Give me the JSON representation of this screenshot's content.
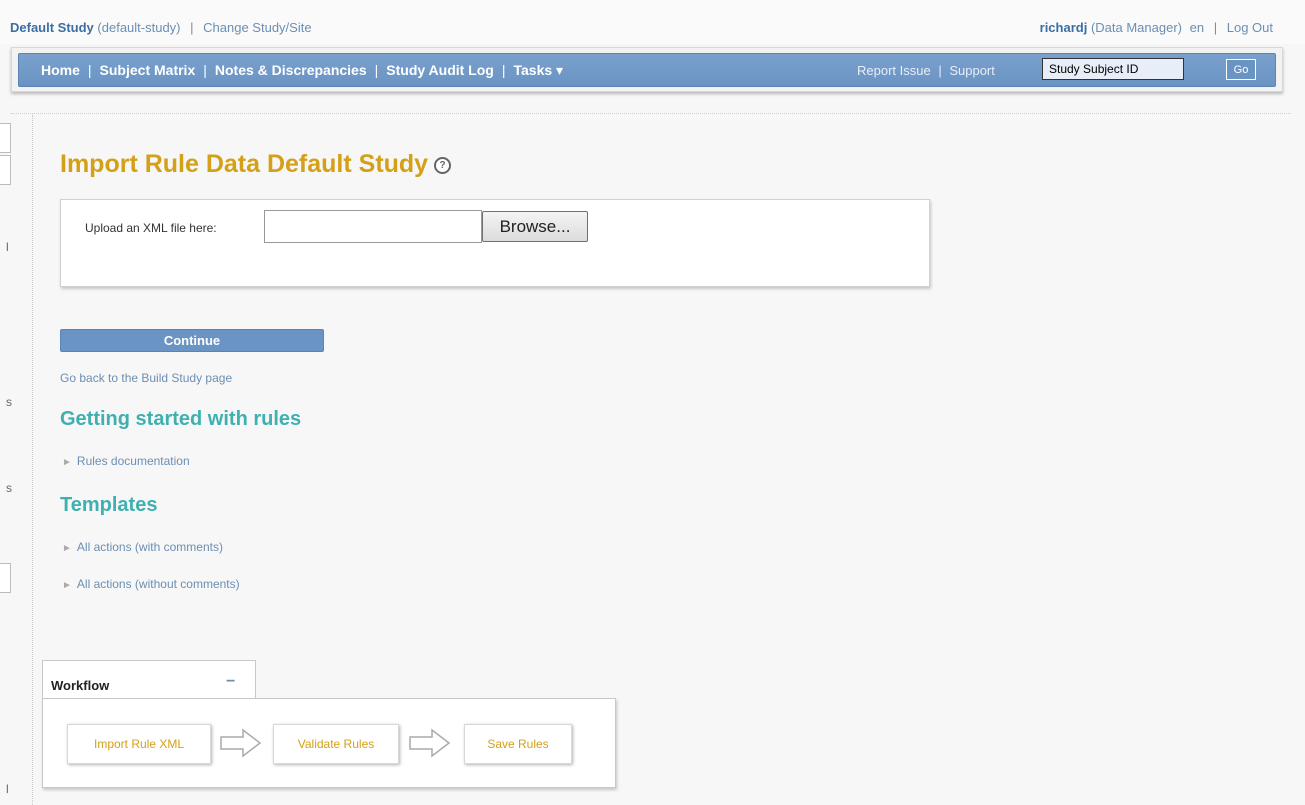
{
  "study_bar": {
    "study_name": "Default Study",
    "study_id": "(default-study)",
    "change_link": "Change Study/Site",
    "user": "richardj",
    "role": "(Data Manager)",
    "lang": "en",
    "logout": "Log Out"
  },
  "nav": {
    "items": [
      "Home",
      "Subject Matrix",
      "Notes & Discrepancies",
      "Study Audit Log",
      "Tasks ▾"
    ],
    "report_issue": "Report Issue",
    "support": "Support",
    "search_value": "Study Subject ID",
    "go_label": "Go"
  },
  "main": {
    "title": "Import Rule Data Default Study",
    "upload_label": "Upload an XML file here:",
    "browse_label": "Browse...",
    "continue_label": "Continue",
    "go_back_link": "Go back to the Build Study page",
    "getting_started_heading": "Getting started with rules",
    "rules_doc_link": "Rules documentation",
    "templates_heading": "Templates",
    "template_links": [
      "All actions (with comments)",
      "All actions (without comments)"
    ]
  },
  "workflow": {
    "title": "Workflow",
    "minimize": "−",
    "steps": [
      "Import Rule XML",
      "Validate Rules",
      "Save Rules"
    ]
  },
  "sidebar_fragments": [
    "l",
    "s",
    "s",
    "l"
  ],
  "colors": {
    "accent_gold": "#d4a017",
    "nav_blue": "#6a94c4",
    "link_blue": "#6b8fb3",
    "section_teal": "#3fb0b0"
  }
}
